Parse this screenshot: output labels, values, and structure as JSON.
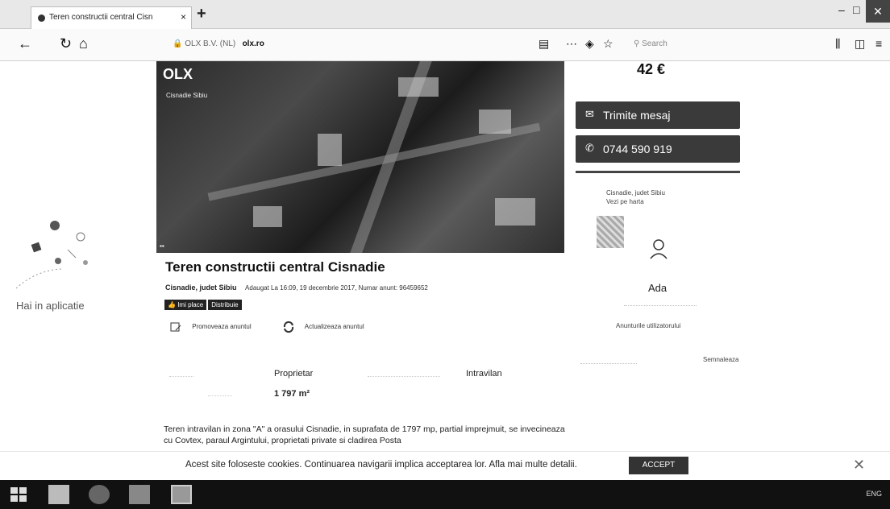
{
  "browser": {
    "tab_title": "Teren constructii central Cisn",
    "tab_close": "×",
    "new_tab": "+",
    "url_prefix": "OLX B.V. (NL)",
    "url_domain": "olx.ro",
    "search_placeholder": "Search",
    "win_min": "–",
    "win_max": "□",
    "win_close": "✕"
  },
  "listing": {
    "price": "42 €",
    "send_message": "Trimite mesaj",
    "phone": "0744 590 919",
    "seller_location": "Cisnadie, judet Sibiu",
    "seller_map_link": "Vezi pe harta",
    "seller_name": "Ada",
    "seller_ads": "Anunturile utilizatorului",
    "report": "Semnaleaza",
    "title": "Teren constructii central Cisnadie",
    "location": "Cisnadie, judet Sibiu",
    "added": "Adaugat La 16:09, 19 decembrie 2017, Numar anunt: 96459652",
    "tag_like": "Imi place",
    "tag_share": "Distribuie",
    "action_promote": "Promoveaza anuntul",
    "action_refresh": "Actualizeaza anuntul",
    "photo_logo": "OLX",
    "photo_location": "Cisnadie Sibiu",
    "param_offer": "Proprietar",
    "param_type": "Intravilan",
    "param_area": "1 797 m²",
    "description": "Teren intravilan in zona \"A\" a orasului Cisnadie, in suprafata de 1797 mp, partial imprejmuit, se invecineaza cu Covtex, paraul Argintului, proprietati private si cladirea Posta"
  },
  "side_promo": {
    "text": "Hai in aplicatie"
  },
  "cookies": {
    "text": "Acest site foloseste cookies. Continuarea navigarii implica acceptarea lor. Afla mai multe detalii.",
    "accept": "ACCEPT",
    "close": "✕"
  },
  "taskbar": {
    "tray_lang": "ENG"
  }
}
